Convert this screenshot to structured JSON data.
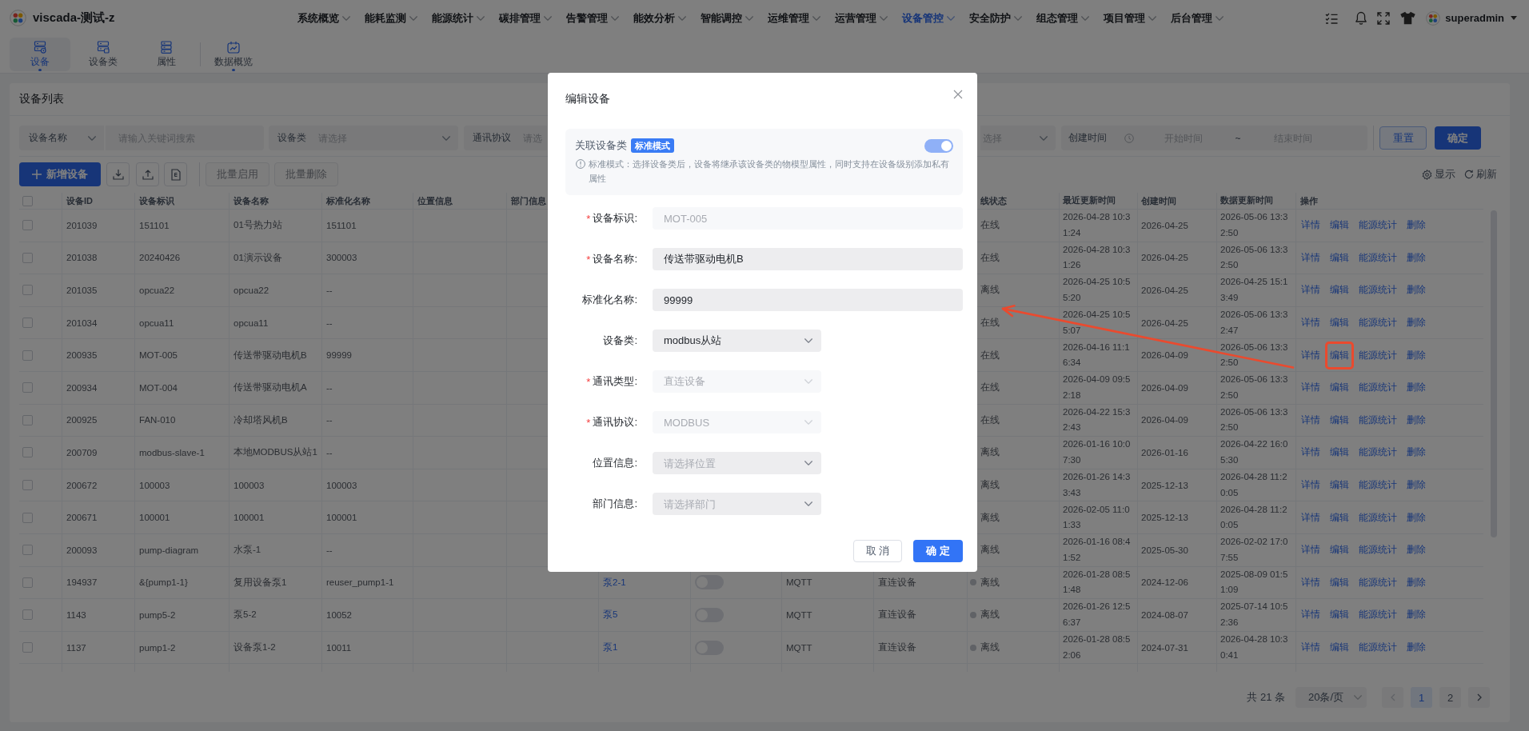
{
  "header": {
    "app_title": "viscada-测试-z",
    "nav": [
      {
        "label": "系统概览",
        "selected": false
      },
      {
        "label": "能耗监测",
        "selected": false
      },
      {
        "label": "能源统计",
        "selected": false
      },
      {
        "label": "碳排管理",
        "selected": false
      },
      {
        "label": "告警管理",
        "selected": false
      },
      {
        "label": "能效分析",
        "selected": false
      },
      {
        "label": "智能调控",
        "selected": false
      },
      {
        "label": "运维管理",
        "selected": false
      },
      {
        "label": "运营管理",
        "selected": false
      },
      {
        "label": "设备管控",
        "selected": true
      },
      {
        "label": "安全防护",
        "selected": false
      },
      {
        "label": "组态管理",
        "selected": false
      },
      {
        "label": "项目管理",
        "selected": false
      },
      {
        "label": "后台管理",
        "selected": false
      }
    ],
    "user": "superadmin"
  },
  "subnav": [
    [
      {
        "label": "设备",
        "selected": true,
        "dot": true
      },
      {
        "label": "设备类",
        "selected": false,
        "dot": false
      },
      {
        "label": "属性",
        "selected": false,
        "dot": false
      }
    ],
    [
      {
        "label": "数据概览",
        "selected": false,
        "dot": true
      }
    ]
  ],
  "panel": {
    "title": "设备列表",
    "filters": [
      {
        "kind": "select",
        "value": "设备名称"
      },
      {
        "kind": "search",
        "placeholder": "请输入关键词搜索"
      },
      {
        "kind": "labeled-select",
        "label": "设备类",
        "placeholder": "请选择"
      },
      {
        "kind": "select-cut-right",
        "label": "通讯协议",
        "placeholder": "请选"
      },
      {
        "kind": "select-cut-left",
        "placeholder": "选择"
      },
      {
        "kind": "date-range",
        "label": "创建时间",
        "start_placeholder": "开始时间",
        "separator": "~",
        "end_placeholder": "结束时间"
      }
    ],
    "filter_buttons": [
      {
        "label": "重置",
        "primary": false
      },
      {
        "label": "确定",
        "primary": true
      }
    ],
    "add_button": "新增设备",
    "batch_buttons": [
      {
        "label": "批量启用",
        "disabled": true
      },
      {
        "label": "批量删除",
        "disabled": true
      }
    ],
    "table_tools": [
      "显示",
      "刷新"
    ],
    "table": {
      "header": {
        "checked": false,
        "device_id": "设备ID",
        "device_tag": "设备标识",
        "device_name": "设备名称",
        "standard_name": "标准化名称",
        "location": "位置信息",
        "department": "部门信息",
        "column_12": "线状态",
        "last_update": "最近更新时间",
        "created": "创建时间",
        "data_update": "数据更新时间",
        "actions": "操作"
      },
      "rows": [
        {
          "checked": false,
          "device_id": "201039",
          "device_tag": "151101",
          "device_name": "01号热力站",
          "standard_name": "151101",
          "column_12": {
            "label": "在线"
          },
          "last_update": "2026-04-28 10:31:24",
          "created": "2026-04-25",
          "data_update": "2026-05-06 13:32:50",
          "actions": [
            {
              "label": "详情",
              "highlighted": false
            },
            {
              "label": "编辑",
              "highlighted": false
            },
            {
              "label": "能源统计",
              "highlighted": false
            },
            {
              "label": "删除",
              "highlighted": false
            }
          ]
        },
        {
          "checked": false,
          "device_id": "201038",
          "device_tag": "20240426",
          "device_name": "01演示设备",
          "standard_name": "300003",
          "column_12": {
            "label": "在线"
          },
          "last_update": "2026-04-28 10:31:26",
          "created": "2026-04-25",
          "data_update": "2026-05-06 13:32:50",
          "actions": [
            {
              "label": "详情",
              "highlighted": false
            },
            {
              "label": "编辑",
              "highlighted": false
            },
            {
              "label": "能源统计",
              "highlighted": false
            },
            {
              "label": "删除",
              "highlighted": false
            }
          ]
        },
        {
          "checked": false,
          "device_id": "201035",
          "device_tag": "opcua22",
          "device_name": "opcua22",
          "standard_name": "--",
          "column_12": {
            "label": "离线"
          },
          "last_update": "2026-04-25 10:55:20",
          "created": "2026-04-25",
          "data_update": "2026-04-25 15:13:49",
          "actions": [
            {
              "label": "详情",
              "highlighted": false
            },
            {
              "label": "编辑",
              "highlighted": false
            },
            {
              "label": "能源统计",
              "highlighted": false
            },
            {
              "label": "删除",
              "highlighted": false
            }
          ]
        },
        {
          "checked": false,
          "device_id": "201034",
          "device_tag": "opcua11",
          "device_name": "opcua11",
          "standard_name": "--",
          "column_12": {
            "label": "在线"
          },
          "last_update": "2026-04-25 10:55:07",
          "created": "2026-04-25",
          "data_update": "2026-05-06 13:32:47",
          "actions": [
            {
              "label": "详情",
              "highlighted": false
            },
            {
              "label": "编辑",
              "highlighted": false
            },
            {
              "label": "能源统计",
              "highlighted": false
            },
            {
              "label": "删除",
              "highlighted": false
            }
          ]
        },
        {
          "checked": false,
          "device_id": "200935",
          "device_tag": "MOT-005",
          "device_name": "传送带驱动电机B",
          "standard_name": "99999",
          "column_12": {
            "label": "在线"
          },
          "last_update": "2026-04-16 11:16:34",
          "created": "2026-04-09",
          "data_update": "2026-05-06 13:32:50",
          "actions": [
            {
              "label": "详情",
              "highlighted": false
            },
            {
              "label": "编辑",
              "highlighted": true
            },
            {
              "label": "能源统计",
              "highlighted": false
            },
            {
              "label": "删除",
              "highlighted": false
            }
          ]
        },
        {
          "checked": false,
          "device_id": "200934",
          "device_tag": "MOT-004",
          "device_name": "传送带驱动电机A",
          "standard_name": "--",
          "column_12": {
            "label": "在线"
          },
          "last_update": "2026-04-09 09:52:18",
          "created": "2026-04-09",
          "data_update": "2026-05-06 13:32:50",
          "actions": [
            {
              "label": "详情",
              "highlighted": false
            },
            {
              "label": "编辑",
              "highlighted": false
            },
            {
              "label": "能源统计",
              "highlighted": false
            },
            {
              "label": "删除",
              "highlighted": false
            }
          ]
        },
        {
          "checked": false,
          "device_id": "200925",
          "device_tag": "FAN-010",
          "device_name": "冷却塔风机B",
          "standard_name": "--",
          "column_12": {
            "label": "在线"
          },
          "last_update": "2026-04-22 15:32:43",
          "created": "2026-04-09",
          "data_update": "2026-05-06 13:32:50",
          "actions": [
            {
              "label": "详情",
              "highlighted": false
            },
            {
              "label": "编辑",
              "highlighted": false
            },
            {
              "label": "能源统计",
              "highlighted": false
            },
            {
              "label": "删除",
              "highlighted": false
            }
          ]
        },
        {
          "checked": false,
          "device_id": "200709",
          "device_tag": "modbus-slave-1",
          "device_name": "本地MODBUS从站1",
          "standard_name": "--",
          "column_12": {
            "label": "离线"
          },
          "last_update": "2026-01-16 10:07:30",
          "created": "2026-01-16",
          "data_update": "2026-04-22 16:05:30",
          "actions": [
            {
              "label": "详情",
              "highlighted": false
            },
            {
              "label": "编辑",
              "highlighted": false
            },
            {
              "label": "能源统计",
              "highlighted": false
            },
            {
              "label": "删除",
              "highlighted": false
            }
          ]
        },
        {
          "checked": false,
          "device_id": "200672",
          "device_tag": "100003",
          "device_name": "100003",
          "standard_name": "100003",
          "column_12": {
            "label": "离线"
          },
          "last_update": "2026-01-26 14:33:43",
          "created": "2025-12-13",
          "data_update": "2026-04-28 11:20:05",
          "actions": [
            {
              "label": "详情",
              "highlighted": false
            },
            {
              "label": "编辑",
              "highlighted": false
            },
            {
              "label": "能源统计",
              "highlighted": false
            },
            {
              "label": "删除",
              "highlighted": false
            }
          ]
        },
        {
          "checked": false,
          "device_id": "200671",
          "device_tag": "100001",
          "device_name": "100001",
          "standard_name": "100001",
          "column_12": {
            "label": "离线"
          },
          "last_update": "2026-02-05 11:01:33",
          "created": "2025-12-13",
          "data_update": "2026-04-28 11:20:05",
          "actions": [
            {
              "label": "详情",
              "highlighted": false
            },
            {
              "label": "编辑",
              "highlighted": false
            },
            {
              "label": "能源统计",
              "highlighted": false
            },
            {
              "label": "删除",
              "highlighted": false
            }
          ]
        },
        {
          "checked": false,
          "device_id": "200093",
          "device_tag": "pump-diagram",
          "device_name": "水泵-1",
          "standard_name": "--",
          "column_12": {
            "label": "离线"
          },
          "last_update": "2026-01-16 08:41:52",
          "created": "2025-05-30",
          "data_update": "2026-02-02 17:07:55",
          "actions": [
            {
              "label": "详情",
              "highlighted": false
            },
            {
              "label": "编辑",
              "highlighted": false
            },
            {
              "label": "能源统计",
              "highlighted": false
            },
            {
              "label": "删除",
              "highlighted": false
            }
          ]
        },
        {
          "checked": false,
          "device_id": "194937",
          "device_tag": "&{pump1-1}",
          "device_name": "复用设备泵1",
          "standard_name": "reuser_pump1-1",
          "column_8": "泵2-1",
          "column_9": {
            "on": false
          },
          "column_10": "MQTT",
          "column_11": "直连设备",
          "column_12": {
            "label": "离线",
            "color": "#606266"
          },
          "last_update": "2026-01-28 08:51:48",
          "created": "2024-12-06",
          "data_update": "2025-08-09 01:51:09",
          "actions": [
            {
              "label": "详情",
              "highlighted": false
            },
            {
              "label": "编辑",
              "highlighted": false
            },
            {
              "label": "能源统计",
              "highlighted": false
            },
            {
              "label": "删除",
              "highlighted": false
            }
          ]
        },
        {
          "checked": false,
          "device_id": "1143",
          "device_tag": "pump5-2",
          "device_name": "泵5-2",
          "standard_name": "10052",
          "column_8": "泵5",
          "column_9": {
            "on": false
          },
          "column_10": "MQTT",
          "column_11": "直连设备",
          "column_12": {
            "label": "离线",
            "color": "#606266"
          },
          "last_update": "2026-01-26 12:56:37",
          "created": "2024-08-07",
          "data_update": "2025-07-14 10:52:36",
          "actions": [
            {
              "label": "详情",
              "highlighted": false
            },
            {
              "label": "编辑",
              "highlighted": false
            },
            {
              "label": "能源统计",
              "highlighted": false
            },
            {
              "label": "删除",
              "highlighted": false
            }
          ]
        },
        {
          "checked": false,
          "device_id": "1137",
          "device_tag": "pump1-2",
          "device_name": "设备泵1-2",
          "standard_name": "10011",
          "column_8": "泵1",
          "column_9": {
            "on": false
          },
          "column_10": "MQTT",
          "column_11": "直连设备",
          "column_12": {
            "label": "离线",
            "color": "#606266"
          },
          "last_update": "2026-01-28 08:52:06",
          "created": "2024-07-31",
          "data_update": "2026-04-28 10:30:41",
          "actions": [
            {
              "label": "详情",
              "highlighted": false
            },
            {
              "label": "编辑",
              "highlighted": false
            },
            {
              "label": "能源统计",
              "highlighted": false
            },
            {
              "label": "删除",
              "highlighted": false
            }
          ]
        }
      ]
    },
    "pagination": {
      "total": "共 21 条",
      "page_size": "20条/页",
      "prev_disabled": true,
      "pages": [
        {
          "label": "1",
          "selected": true
        },
        {
          "label": "2",
          "selected": false
        }
      ]
    }
  },
  "modal": {
    "title": "编辑设备",
    "link_class": {
      "label": "关联设备类",
      "badge": "标准模式",
      "on": true,
      "disabled": true,
      "description": "标准模式：选择设备类后，设备将继承该设备类的物模型属性，同时支持在设备级别添加私有属性"
    },
    "fields": [
      {
        "mark": "*",
        "label": "设备标识:",
        "kind": "input",
        "value": "MOT-005",
        "disabled": true
      },
      {
        "mark": "*",
        "label": "设备名称:",
        "kind": "input",
        "value": "传送带驱动电机B",
        "disabled": false
      },
      {
        "label": "标准化名称:",
        "kind": "input",
        "value": "99999",
        "disabled": false
      },
      {
        "label": "设备类:",
        "kind": "select",
        "value": "modbus从站",
        "disabled": false
      },
      {
        "mark": "*",
        "label": "通讯类型:",
        "kind": "select",
        "value": "直连设备",
        "disabled": true
      },
      {
        "mark": "*",
        "label": "通讯协议:",
        "kind": "select",
        "value": "MODBUS",
        "disabled": true
      },
      {
        "label": "位置信息:",
        "kind": "select",
        "placeholder": "请选择位置",
        "disabled": false
      },
      {
        "label": "部门信息:",
        "kind": "select",
        "placeholder": "请选择部门",
        "disabled": false
      }
    ],
    "buttons": [
      {
        "label": "取 消",
        "primary": false
      },
      {
        "label": "确 定",
        "primary": true
      }
    ]
  }
}
